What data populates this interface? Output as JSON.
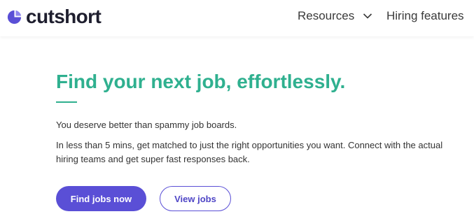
{
  "brand": {
    "name": "cutshort",
    "logo_icon": "cutshort-logo-icon",
    "brand_color": "#5a4fd6"
  },
  "nav": {
    "resources_label": "Resources",
    "resources_icon": "chevron-down-icon",
    "hiring_label": "Hiring features"
  },
  "hero": {
    "headline": "Find your next job, effortlessly.",
    "accent_color": "#2fb08f",
    "tagline": "You deserve better than spammy job boards.",
    "description_line1": "In less than 5 mins, get matched to just the right opportunities you want. Connect with the actual",
    "description_line2": "hiring teams and get super fast responses back.",
    "primary_button": "Find jobs now",
    "secondary_button": "View jobs"
  }
}
